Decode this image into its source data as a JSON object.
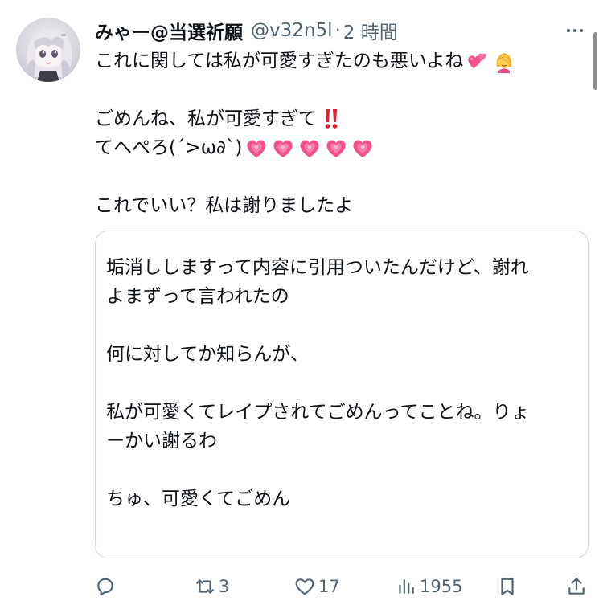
{
  "tweet": {
    "author": {
      "display_name": "みゃー@当選祈願",
      "handle": "@v32n5l",
      "separator": "·",
      "time": "2 時間"
    },
    "lines": [
      "これに関しては私が可愛すぎたのも悪いよね",
      "",
      "ごめんね、私が可愛すぎて",
      "てへぺろ(´>ω∂`)",
      "",
      "これでいい？私は謝りましたよ"
    ],
    "emoji": {
      "line1": [
        "two-hearts",
        "person-facepalming"
      ],
      "line3": [
        "double-exclamation"
      ],
      "line4": [
        "growing-heart",
        "growing-heart",
        "growing-heart",
        "growing-heart",
        "growing-heart"
      ]
    },
    "quote": {
      "lines": [
        "垢消ししますって内容に引用ついたんだけど、謝れ",
        "よまずって言われたの",
        "",
        "何に対してか知らんが、",
        "",
        "私が可愛くてレイプされてごめんってことね。りょ",
        "ーかい謝るわ",
        "",
        "ちゅ、可愛くてごめん"
      ]
    },
    "actions": {
      "reply": {
        "icon": "reply-icon",
        "count": ""
      },
      "retweet": {
        "icon": "retweet-icon",
        "count": "3"
      },
      "like": {
        "icon": "heart-icon",
        "count": "17"
      },
      "views": {
        "icon": "views-icon",
        "count": "1955"
      },
      "bookmark": {
        "icon": "bookmark-icon",
        "count": ""
      },
      "share": {
        "icon": "share-icon",
        "count": ""
      }
    }
  },
  "colors": {
    "text": "#0f1419",
    "secondary": "#536471",
    "border": "#cfd9de",
    "heart_pink": "#f4508b",
    "exclamation_red": "#e0202e"
  }
}
